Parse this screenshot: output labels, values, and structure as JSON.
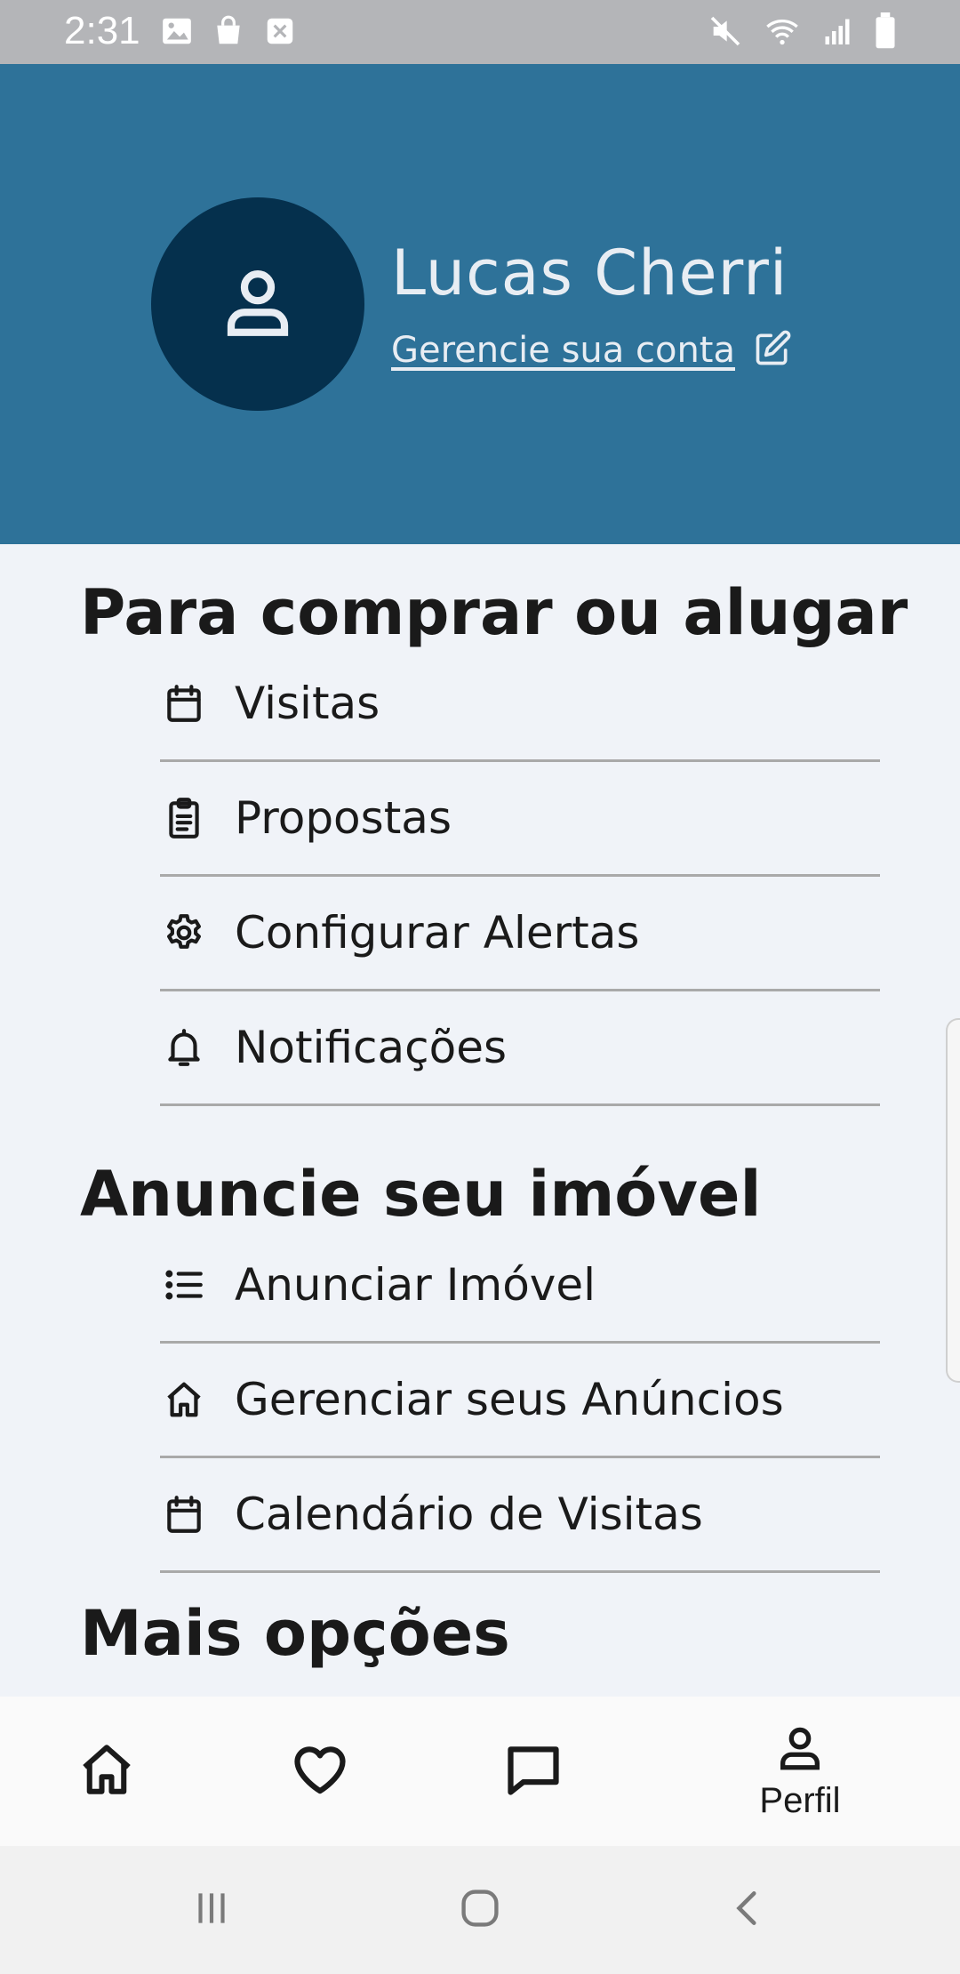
{
  "status_bar": {
    "time": "2:31",
    "left_icons": [
      "image-icon",
      "bag-icon",
      "close-box-icon"
    ],
    "right_icons": [
      "mute-icon",
      "wifi-icon",
      "signal-icon",
      "battery-icon"
    ]
  },
  "header": {
    "user_name": "Lucas Cherri",
    "manage_label": "Gerencie sua conta",
    "background_color": "#2e7299",
    "avatar_color": "#05304d"
  },
  "sections": [
    {
      "title": "Para comprar ou alugar",
      "items": [
        {
          "label": "Visitas",
          "icon": "calendar-icon"
        },
        {
          "label": "Propostas",
          "icon": "clipboard-icon"
        },
        {
          "label": "Configurar Alertas",
          "icon": "gear-icon"
        },
        {
          "label": "Notificações",
          "icon": "bell-icon"
        }
      ]
    },
    {
      "title": "Anuncie seu imóvel",
      "items": [
        {
          "label": "Anunciar Imóvel",
          "icon": "list-icon"
        },
        {
          "label": "Gerenciar seus Anúncios",
          "icon": "home-icon"
        },
        {
          "label": "Calendário de Visitas",
          "icon": "calendar-icon"
        }
      ]
    },
    {
      "title": "Mais opções",
      "items": []
    }
  ],
  "bottom_nav": {
    "items": [
      {
        "icon": "home-icon",
        "label": ""
      },
      {
        "icon": "heart-icon",
        "label": ""
      },
      {
        "icon": "chat-icon",
        "label": ""
      },
      {
        "icon": "person-icon",
        "label": "Perfil"
      }
    ],
    "active": "Perfil"
  },
  "system_nav": [
    "recent-apps-icon",
    "home-circle-icon",
    "back-icon"
  ]
}
